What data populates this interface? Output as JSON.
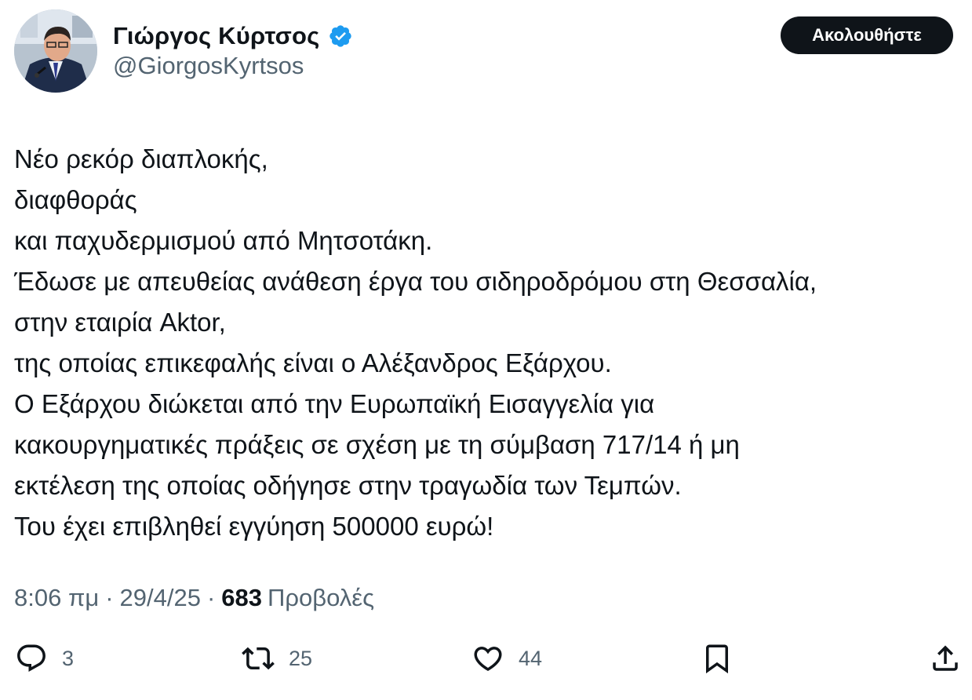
{
  "author": {
    "display_name": "Γιώργος Κύρτσος",
    "handle": "@GiorgosKyrtsos",
    "verified_icon": "verified-badge-icon",
    "verified_color": "#1d9bf0"
  },
  "follow_button": {
    "label": "Ακολουθήστε"
  },
  "tweet": {
    "lines": [
      "Νέο ρεκόρ διαπλοκής,",
      "διαφθοράς",
      "και παχυδερμισμού από Μητσοτάκη.",
      "Έδωσε με απευθείας ανάθεση έργα του σιδηροδρόμου στη Θεσσαλία,",
      "στην εταιρία Aktor,",
      "της οποίας επικεφαλής είναι ο Αλέξανδρος Εξάρχου.",
      "Ο Εξάρχου διώκεται από την Ευρωπαϊκή Εισαγγελία για",
      "κακουργηματικές πράξεις σε σχέση με τη σύμβαση 717/14 ή μη",
      "εκτέλεση της οποίας οδήγησε στην τραγωδία των Τεμπών.",
      "Του έχει επιβληθεί εγγύηση 500000 ευρώ!"
    ]
  },
  "meta": {
    "time": "8:06 πμ",
    "separator": "·",
    "date": "29/4/25",
    "views_count": "683",
    "views_label": "Προβολές"
  },
  "actions": {
    "reply": {
      "icon": "reply-icon",
      "count": "3"
    },
    "retweet": {
      "icon": "retweet-icon",
      "count": "25"
    },
    "like": {
      "icon": "heart-icon",
      "count": "44"
    },
    "bookmark": {
      "icon": "bookmark-icon"
    },
    "share": {
      "icon": "share-icon"
    }
  },
  "colors": {
    "text_primary": "#0f1419",
    "text_secondary": "#536471",
    "button_bg": "#0f1419",
    "button_text": "#ffffff"
  }
}
